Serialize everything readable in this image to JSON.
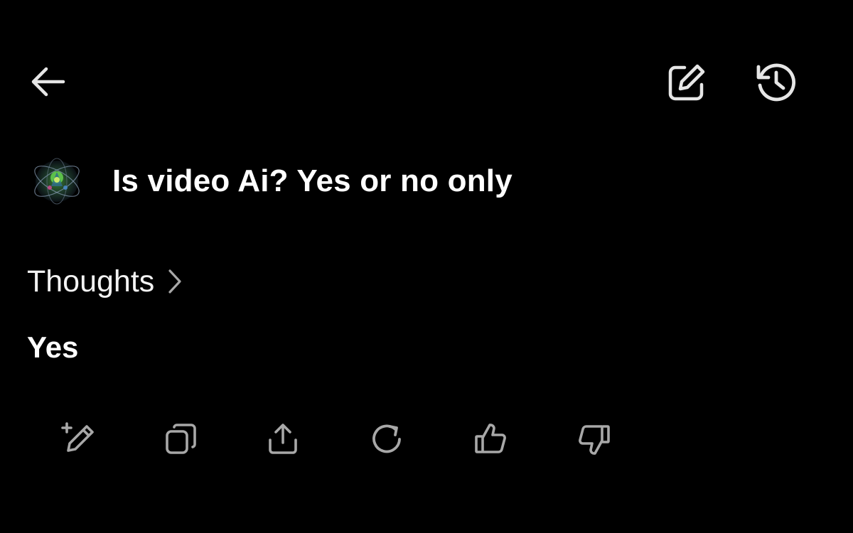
{
  "header": {
    "back_icon": "arrow-left-icon",
    "new_chat_icon": "edit-square-icon",
    "history_icon": "history-icon"
  },
  "message": {
    "avatar_icon": "grok-avatar-icon",
    "prompt": "Is video Ai? Yes or no only"
  },
  "thoughts": {
    "label": "Thoughts",
    "chevron_icon": "chevron-right-icon"
  },
  "response": {
    "text": "Yes"
  },
  "actions": [
    {
      "icon": "edit-sparkle-icon"
    },
    {
      "icon": "copy-icon"
    },
    {
      "icon": "share-icon"
    },
    {
      "icon": "regenerate-icon"
    },
    {
      "icon": "thumbs-up-icon"
    },
    {
      "icon": "thumbs-down-icon"
    }
  ],
  "colors": {
    "background": "#000000",
    "text": "#ffffff",
    "icon_primary": "#e6e6e6",
    "icon_secondary": "#a8a8a8"
  }
}
